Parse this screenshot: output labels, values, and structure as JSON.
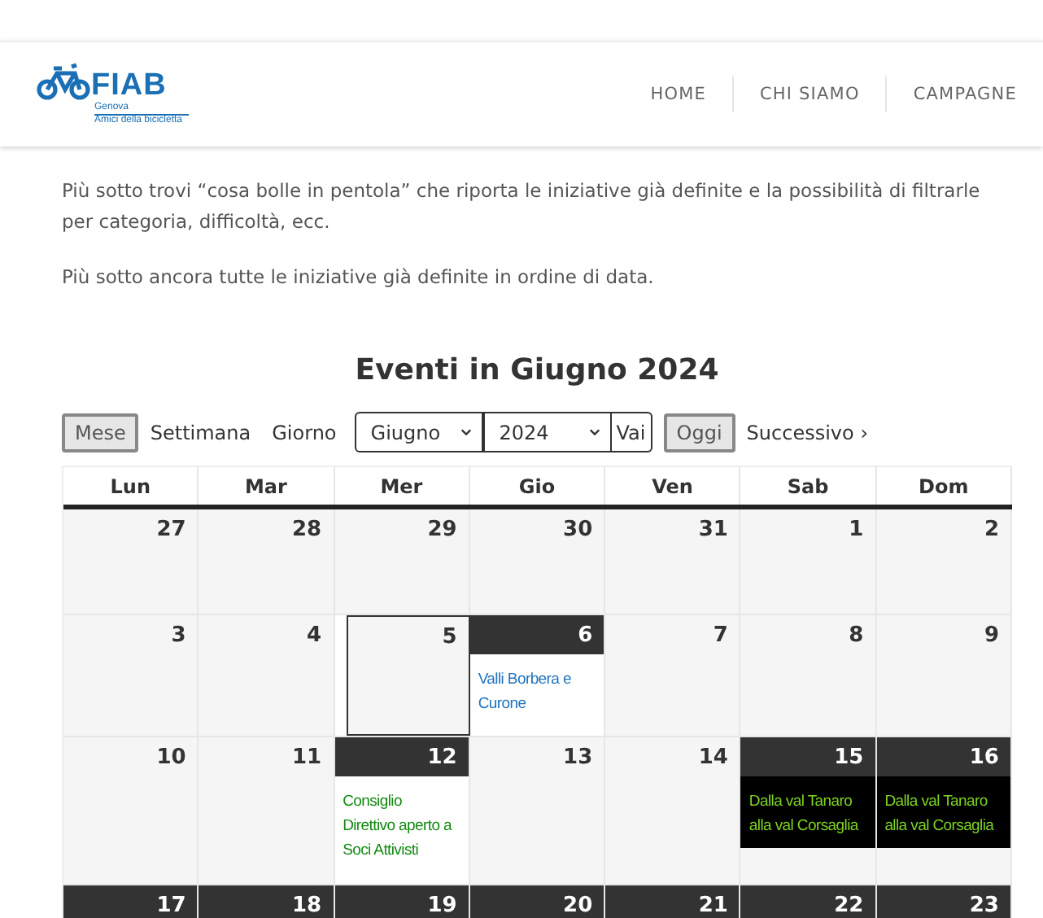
{
  "header": {
    "logo": {
      "name": "FIAB",
      "line1": "Genova",
      "line2": "Amici della bicicletta"
    },
    "nav": [
      "HOME",
      "CHI SIAMO",
      "CAMPAGNE"
    ]
  },
  "paragraphs": [
    "Più sotto trovi “cosa bolle in pentola” che riporta le iniziative già definite e la possibilità di filtrarle per categoria, difficoltà, ecc.",
    "Più sotto ancora tutte le iniziative già definite in ordine di data."
  ],
  "calendar": {
    "title": "Eventi in Giugno 2024",
    "views": [
      {
        "label": "Mese",
        "selected": true
      },
      {
        "label": "Settimana",
        "selected": false
      },
      {
        "label": "Giorno",
        "selected": false
      }
    ],
    "month_select": "Giugno",
    "year_select": "2024",
    "go_button": "Vai",
    "today_button": "Oggi",
    "next": "Successivo ›",
    "weekdays": [
      "Lun",
      "Mar",
      "Mer",
      "Gio",
      "Ven",
      "Sab",
      "Dom"
    ],
    "weeks": [
      [
        {
          "day": "27",
          "today": false,
          "highlighted": false
        },
        {
          "day": "28",
          "today": false,
          "highlighted": false
        },
        {
          "day": "29",
          "today": false,
          "highlighted": false
        },
        {
          "day": "30",
          "today": false,
          "highlighted": false
        },
        {
          "day": "31",
          "today": false,
          "highlighted": false
        },
        {
          "day": "1",
          "today": false,
          "highlighted": false
        },
        {
          "day": "2",
          "today": false,
          "highlighted": false
        }
      ],
      [
        {
          "day": "3",
          "today": false,
          "highlighted": false
        },
        {
          "day": "4",
          "today": false,
          "highlighted": false
        },
        {
          "day": "5",
          "today": true,
          "highlighted": false
        },
        {
          "day": "6",
          "today": false,
          "highlighted": true,
          "events": [
            {
              "title": "Valli Borbera e Curone",
              "kind": "light",
              "color": "#1e73be"
            }
          ]
        },
        {
          "day": "7",
          "today": false,
          "highlighted": false
        },
        {
          "day": "8",
          "today": false,
          "highlighted": false
        },
        {
          "day": "9",
          "today": false,
          "highlighted": false
        }
      ],
      [
        {
          "day": "10",
          "today": false,
          "highlighted": false
        },
        {
          "day": "11",
          "today": false,
          "highlighted": false
        },
        {
          "day": "12",
          "today": false,
          "highlighted": true,
          "events": [
            {
              "title": "Consiglio Direttivo aperto a Soci Attivisti",
              "kind": "light",
              "color": "#118a11"
            }
          ]
        },
        {
          "day": "13",
          "today": false,
          "highlighted": false
        },
        {
          "day": "14",
          "today": false,
          "highlighted": false
        },
        {
          "day": "15",
          "today": false,
          "highlighted": true,
          "events": [
            {
              "title": "Dalla val Tanaro alla val Corsaglia",
              "kind": "dark",
              "color": "#7ed321"
            }
          ]
        },
        {
          "day": "16",
          "today": false,
          "highlighted": true,
          "events": [
            {
              "title": "Dalla val Tanaro alla val Corsaglia",
              "kind": "dark",
              "color": "#7ed321"
            }
          ]
        }
      ],
      [
        {
          "day": "17",
          "today": false,
          "highlighted": true
        },
        {
          "day": "18",
          "today": false,
          "highlighted": true
        },
        {
          "day": "19",
          "today": false,
          "highlighted": true
        },
        {
          "day": "20",
          "today": false,
          "highlighted": true
        },
        {
          "day": "21",
          "today": false,
          "highlighted": true
        },
        {
          "day": "22",
          "today": false,
          "highlighted": true
        },
        {
          "day": "23",
          "today": false,
          "highlighted": true
        }
      ]
    ]
  }
}
